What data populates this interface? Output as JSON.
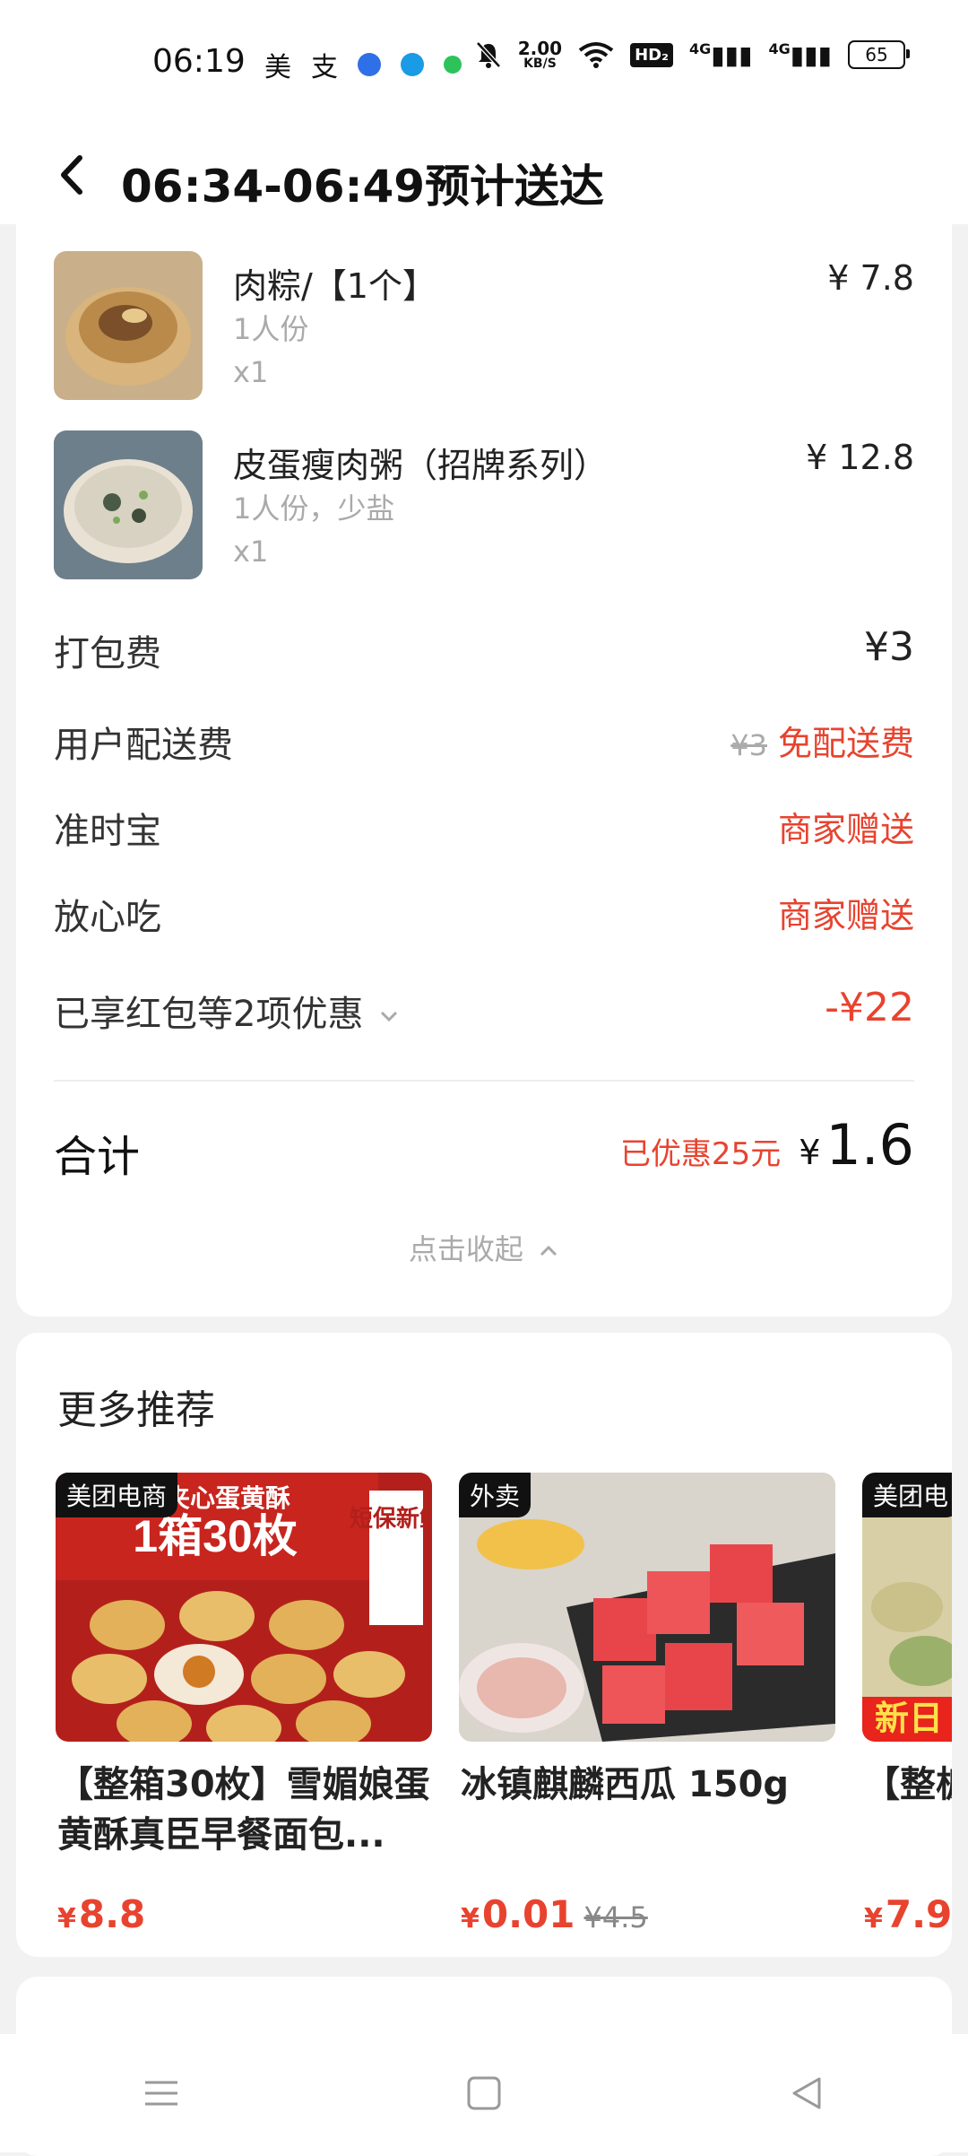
{
  "status_bar": {
    "time": "06:19",
    "app_icons": [
      "美",
      "支"
    ],
    "net_speed_value": "2.00",
    "net_speed_unit": "KB/S",
    "hd_label": "HD₂",
    "signal1": "4G",
    "signal2": "4G",
    "battery": "65"
  },
  "header": {
    "title": "06:34-06:49预计送达"
  },
  "order_items": [
    {
      "name": "肉粽/【1个】",
      "spec": "1人份",
      "qty": "x1",
      "price": "¥ 7.8"
    },
    {
      "name": "皮蛋瘦肉粥（招牌系列）",
      "spec": "1人份，少盐",
      "qty": "x1",
      "price": "¥ 12.8"
    }
  ],
  "fees": {
    "packing": {
      "label": "打包费",
      "value": "¥3"
    },
    "delivery": {
      "label": "用户配送费",
      "original": "¥3",
      "value": "免配送费"
    },
    "ontime": {
      "label": "准时宝",
      "value": "商家赠送"
    },
    "safe": {
      "label": "放心吃",
      "value": "商家赠送"
    },
    "discount": {
      "label": "已享红包等2项优惠",
      "value": "-¥22"
    }
  },
  "total": {
    "label": "合计",
    "saved": "已优惠25元",
    "currency": "¥",
    "amount": "1.6",
    "collapse_label": "点击收起"
  },
  "recommendations": {
    "title": "更多推荐",
    "products": [
      {
        "tag": "美团电商",
        "name": "【整箱30枚】雪媚娘蛋黄酥真臣早餐面包...",
        "currency": "¥",
        "price": "8.8",
        "original": "",
        "img_text_top": "雪媚娘夹心蛋黄酥",
        "img_text_big": "1箱30枚",
        "img_text_side": "短保新鲜"
      },
      {
        "tag": "外卖",
        "name": "冰镇麒麟西瓜 150g",
        "currency": "¥",
        "price": "0.01",
        "original": "¥4.5"
      },
      {
        "tag": "美团电",
        "name": "【整板栗饼",
        "currency": "¥",
        "price": "7.9",
        "original": "",
        "img_badge": "新日"
      }
    ]
  },
  "next_section_title": "",
  "colors": {
    "accent_red": "#e8432f",
    "background": "#f2f2f2",
    "card": "#ffffff"
  }
}
